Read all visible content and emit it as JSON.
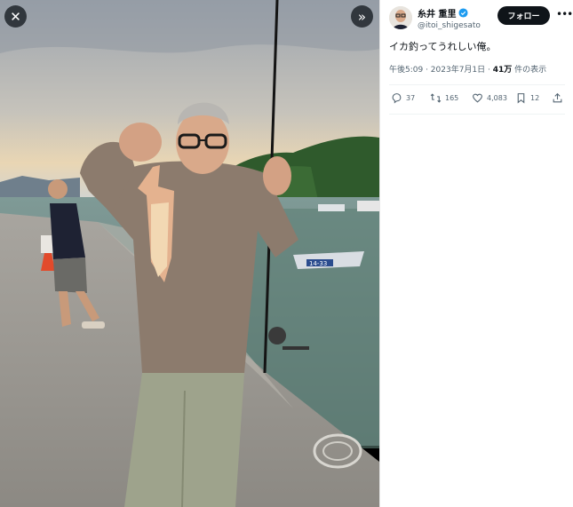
{
  "media": {
    "close_icon": "close-icon",
    "next_icon": "chevron-right-double-icon",
    "boat_number": "14-33",
    "photo_description_icon": "photo"
  },
  "tweet": {
    "author": {
      "display_name": "糸井 重里",
      "handle": "@itoi_shigesato",
      "verified": true,
      "verified_color": "#1d9bf0"
    },
    "follow_label": "フォロー",
    "more_icon": "more-icon",
    "text": "イカ釣ってうれしい俺。",
    "timestamp": "午後5:09 · 2023年7月1日 · ",
    "views_count": "41万",
    "views_label": " 件の表示",
    "stats": {
      "replies": "37",
      "retweets": "165",
      "likes": "4,083",
      "bookmarks": "12"
    }
  }
}
